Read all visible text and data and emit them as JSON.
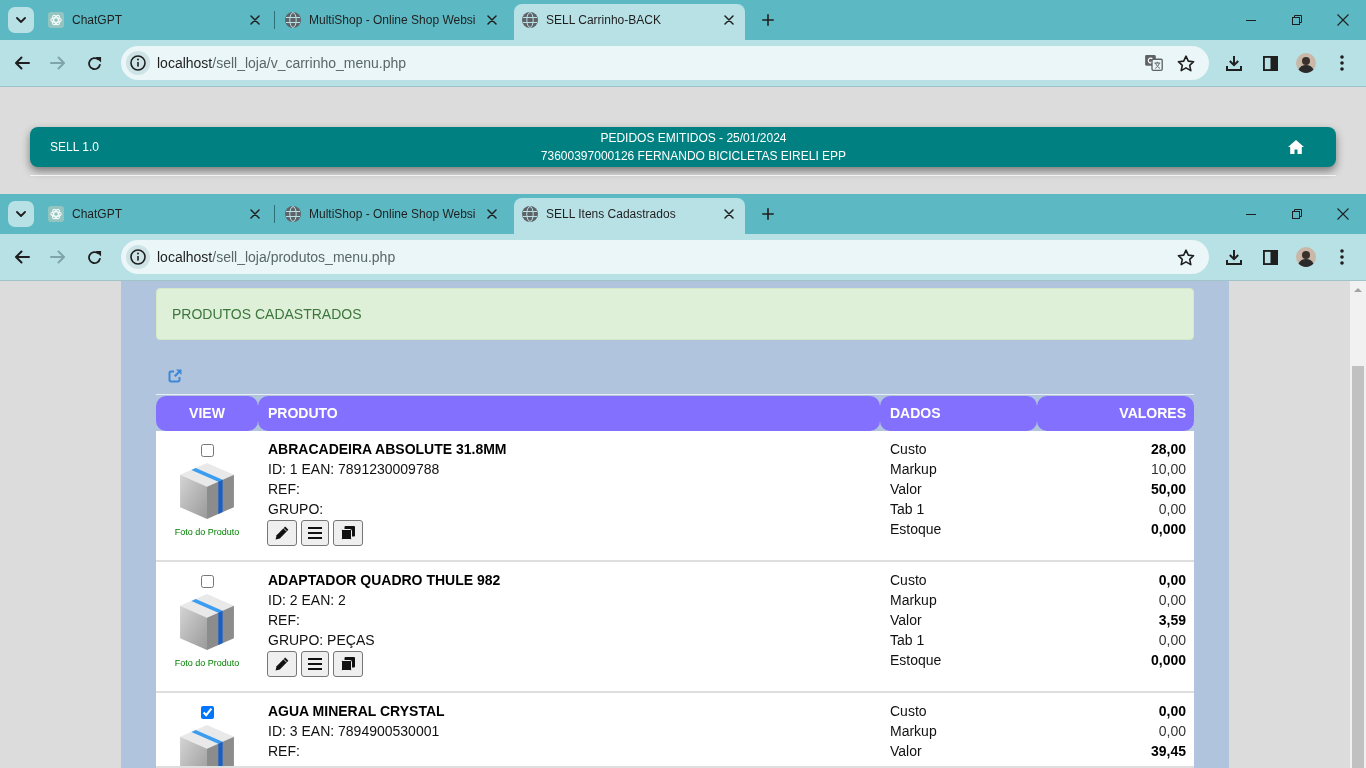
{
  "windows": [
    {
      "tabs": [
        {
          "kind": "logo",
          "title": "ChatGPT",
          "selected": false
        },
        {
          "kind": "globe",
          "title": "MultiShop - Online Shop Websi",
          "selected": false
        },
        {
          "kind": "globe",
          "title": "SELL Carrinho-BACK",
          "selected": true
        }
      ],
      "address": {
        "host": "localhost",
        "path": "/sell_loja/v_carrinho_menu.php",
        "translate": true,
        "forward_disabled": true
      },
      "page": {
        "kind": "header",
        "brand": "SELL 1.0",
        "title": "PEDIDOS EMITIDOS - 25/01/2024",
        "subtitle": "73600397000126 FERNANDO BICICLETAS EIRELI EPP"
      }
    },
    {
      "tabs": [
        {
          "kind": "logo",
          "title": "ChatGPT",
          "selected": false
        },
        {
          "kind": "globe",
          "title": "MultiShop - Online Shop Websi",
          "selected": false
        },
        {
          "kind": "globe",
          "title": "SELL Itens Cadastrados",
          "selected": true
        }
      ],
      "address": {
        "host": "localhost",
        "path": "/sell_loja/produtos_menu.php",
        "translate": false,
        "forward_disabled": true
      },
      "page": {
        "kind": "product_list",
        "banner": "PRODUTOS CADASTRADOS",
        "columns": [
          "VIEW",
          "PRODUTO",
          "DADOS",
          "VALORES"
        ],
        "rows": [
          {
            "checked": false,
            "photo_caption": "Foto do Produto",
            "name": "ABRACADEIRA ABSOLUTE 31.8MM",
            "details": [
              "ID: 1 EAN: 7891230009788",
              "REF:",
              "GRUPO:"
            ],
            "actions": [
              {
                "kind": "edit"
              },
              {
                "kind": "list"
              },
              {
                "kind": "copy"
              }
            ],
            "data": [
              {
                "label": "Custo",
                "value": "28,00",
                "strong": true
              },
              {
                "label": "Markup",
                "value": "10,00",
                "strong": false
              },
              {
                "label": "Valor",
                "value": "50,00",
                "strong": true
              },
              {
                "label": "Tab 1",
                "value": "0,00",
                "strong": false
              },
              {
                "label": "Estoque",
                "value": "0,000",
                "strong": true
              }
            ]
          },
          {
            "checked": false,
            "photo_caption": "Foto do Produto",
            "name": "ADAPTADOR QUADRO THULE 982",
            "details": [
              "ID: 2 EAN: 2",
              "REF:",
              "GRUPO: PEÇAS"
            ],
            "actions": [
              {
                "kind": "edit"
              },
              {
                "kind": "list"
              },
              {
                "kind": "copy"
              }
            ],
            "data": [
              {
                "label": "Custo",
                "value": "0,00",
                "strong": true
              },
              {
                "label": "Markup",
                "value": "0,00",
                "strong": false
              },
              {
                "label": "Valor",
                "value": "3,59",
                "strong": true
              },
              {
                "label": "Tab 1",
                "value": "0,00",
                "strong": false
              },
              {
                "label": "Estoque",
                "value": "0,000",
                "strong": true
              }
            ]
          },
          {
            "checked": true,
            "name": "AGUA MINERAL CRYSTAL",
            "details": [
              "ID: 3 EAN: 7894900530001",
              "REF:"
            ],
            "data": [
              {
                "label": "Custo",
                "value": "0,00",
                "strong": true
              },
              {
                "label": "Markup",
                "value": "0,00",
                "strong": false
              },
              {
                "label": "Valor",
                "value": "39,45",
                "strong": true
              }
            ]
          }
        ]
      }
    }
  ]
}
